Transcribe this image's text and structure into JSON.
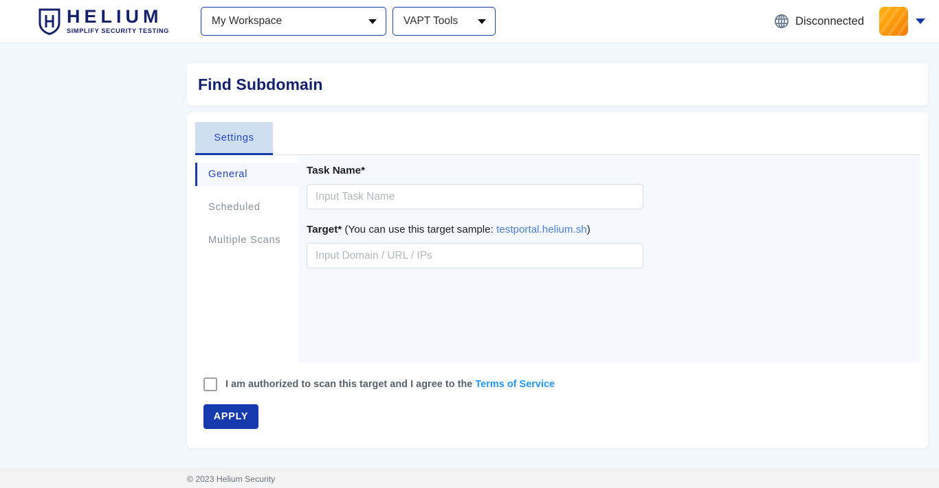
{
  "header": {
    "logo": {
      "icon": "shield-h-icon",
      "word": "HELIUM",
      "tagline": "SIMPLIFY SECURITY TESTING"
    },
    "workspace_select": {
      "value": "My Workspace",
      "icon": "chevron-down-icon"
    },
    "tools_select": {
      "value": "VAPT Tools",
      "icon": "chevron-down-icon"
    },
    "connection": {
      "icon": "globe-icon",
      "status": "Disconnected"
    },
    "avatar": {
      "icon": "user-avatar",
      "color": "#ffa20c"
    },
    "avatar_caret": {
      "icon": "chevron-down-icon",
      "color": "#1437a8"
    }
  },
  "page": {
    "title": "Find Subdomain"
  },
  "tabs": [
    {
      "label": "Settings",
      "active": true
    }
  ],
  "sidenav": {
    "items": [
      {
        "label": "General",
        "active": true
      },
      {
        "label": "Scheduled",
        "active": false
      },
      {
        "label": "Multiple Scans",
        "active": false
      }
    ]
  },
  "form": {
    "task_name": {
      "label": "Task Name*",
      "placeholder": "Input Task Name",
      "value": ""
    },
    "target": {
      "label": "Target*",
      "note_prefix": " (You can use this target sample: ",
      "sample_link": "testportal.helium.sh",
      "note_suffix": ")",
      "placeholder": "Input Domain / URL / IPs",
      "value": ""
    }
  },
  "agreement": {
    "checked": false,
    "text": "I am authorized to scan this target and I agree to the ",
    "link": "Terms of Service"
  },
  "actions": {
    "apply_label": "APPLY"
  },
  "footer": {
    "copyright": "© 2023 Helium Security"
  },
  "colors": {
    "brand_navy": "#16216b",
    "accent_blue": "#1639ad",
    "link_blue": "#2196f3",
    "page_bg": "#f2f6fd",
    "panel_bg": "#f5f8fe"
  }
}
